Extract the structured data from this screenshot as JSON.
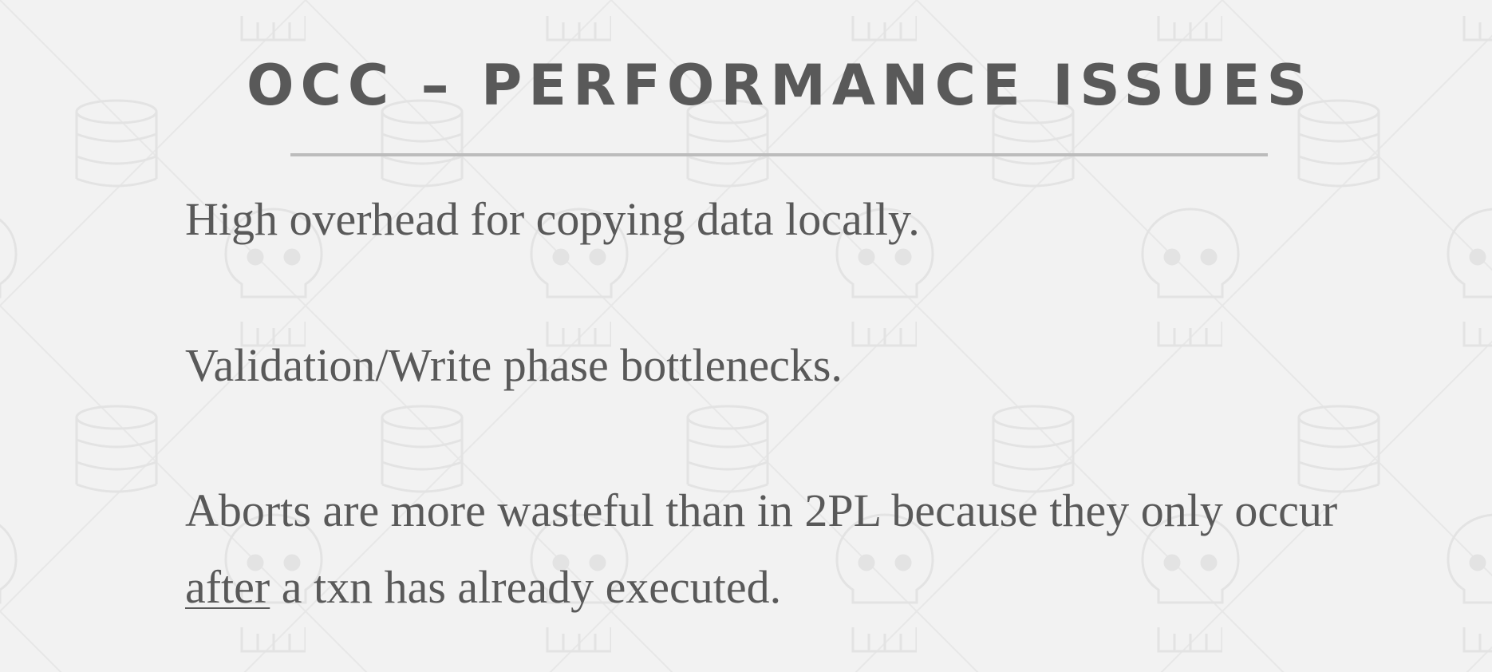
{
  "slide": {
    "title": "OCC – PERFORMANCE ISSUES",
    "bullets": [
      {
        "text": "High overhead for copying data locally."
      },
      {
        "text": "Validation/Write phase bottlenecks."
      },
      {
        "before": "Aborts are more wasteful than in 2PL because they only occur ",
        "emphasis": "after",
        "after": " a txn has already executed."
      }
    ]
  },
  "colors": {
    "background": "#f2f2f2",
    "text": "#595959",
    "rule": "#bcbcbc",
    "pattern": "#e6e6e6"
  },
  "icons": [
    "database-icon",
    "skull-icon"
  ]
}
